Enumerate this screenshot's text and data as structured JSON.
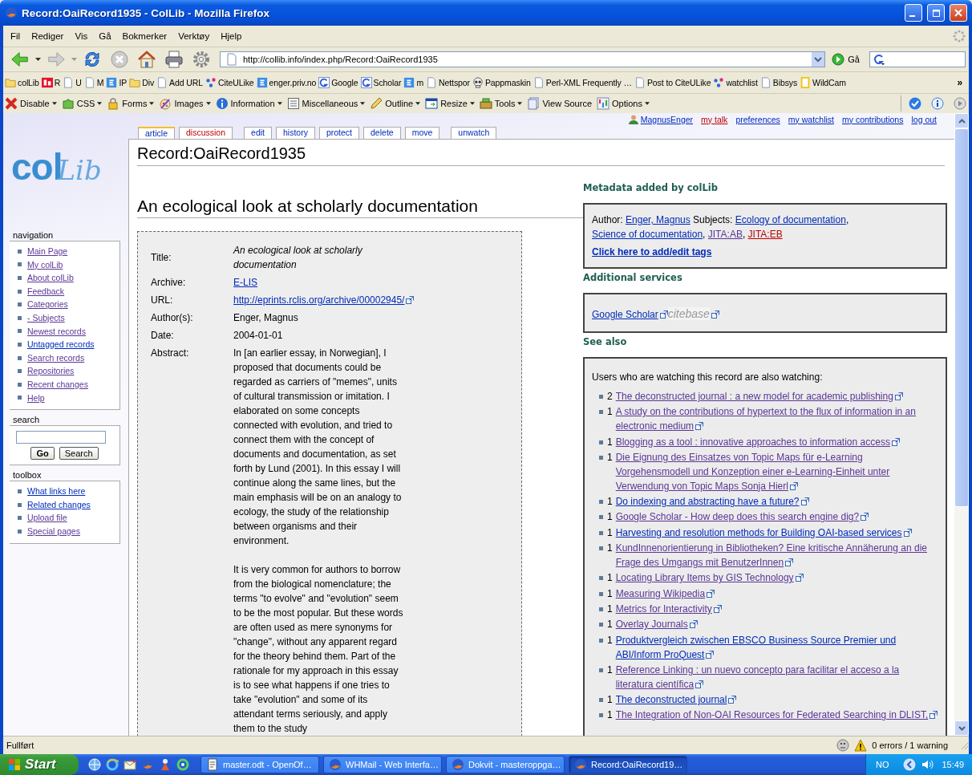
{
  "window": {
    "title": "Record:OaiRecord1935 - ColLib - Mozilla Firefox"
  },
  "menu": [
    "Fil",
    "Rediger",
    "Vis",
    "Gå",
    "Bokmerker",
    "Verktøy",
    "Hjelp"
  ],
  "address": {
    "url": "http://collib.info/index.php/Record:OaiRecord1935",
    "go_label": "Gå"
  },
  "bookmarks": [
    {
      "label": "colLib",
      "kind": "folder"
    },
    {
      "label": "R",
      "kind": "tile-red"
    },
    {
      "label": "U",
      "kind": "page"
    },
    {
      "label": "M",
      "kind": "page"
    },
    {
      "label": "IP",
      "kind": "tile-blue"
    },
    {
      "label": "Div",
      "kind": "folder"
    },
    {
      "label": "Add URL",
      "kind": "page"
    },
    {
      "label": "CiteULike",
      "kind": "dots"
    },
    {
      "label": "enger.priv.no",
      "kind": "tile-blue"
    },
    {
      "label": "Google",
      "kind": "ring"
    },
    {
      "label": "Scholar",
      "kind": "ring"
    },
    {
      "label": "m",
      "kind": "tile-blue"
    },
    {
      "label": "Nettspor",
      "kind": "page"
    },
    {
      "label": "Pappmaskin",
      "kind": "skull"
    },
    {
      "label": "Perl-XML Frequently …",
      "kind": "page"
    },
    {
      "label": "Post to CiteULike",
      "kind": "page"
    },
    {
      "label": "watchlist",
      "kind": "dots"
    },
    {
      "label": "Bibsys",
      "kind": "page"
    },
    {
      "label": "WildCam",
      "kind": "frame"
    }
  ],
  "bookmarks_more": "»",
  "dev_toolbar": [
    {
      "label": "Disable",
      "kind": "cross",
      "menu": true
    },
    {
      "label": "CSS",
      "kind": "puzzle",
      "menu": true
    },
    {
      "label": "Forms",
      "kind": "lock",
      "menu": true
    },
    {
      "label": "Images",
      "kind": "brush",
      "menu": true
    },
    {
      "label": "Information",
      "kind": "info",
      "menu": true
    },
    {
      "label": "Miscellaneous",
      "kind": "list",
      "menu": true
    },
    {
      "label": "Outline",
      "kind": "pencil",
      "menu": true
    },
    {
      "label": "Resize",
      "kind": "window",
      "menu": true
    },
    {
      "label": "Tools",
      "kind": "box",
      "menu": true
    },
    {
      "label": "View Source",
      "kind": "page",
      "menu": false
    },
    {
      "label": "Options",
      "kind": "sliders",
      "menu": true
    }
  ],
  "page": {
    "logo": "colLib",
    "user_links": [
      {
        "label": "MagnusEnger",
        "kind": "user"
      },
      {
        "label": "my talk",
        "kind": "new"
      },
      {
        "label": "preferences",
        "kind": "link"
      },
      {
        "label": "my watchlist",
        "kind": "link"
      },
      {
        "label": "my contributions",
        "kind": "link"
      },
      {
        "label": "log out",
        "kind": "link"
      }
    ],
    "tab_groups": [
      [
        {
          "label": "article",
          "selected": true,
          "kind": "link"
        },
        {
          "label": "discussion",
          "selected": false,
          "kind": "new"
        }
      ],
      [
        {
          "label": "edit",
          "selected": false,
          "kind": "link"
        },
        {
          "label": "history",
          "selected": false,
          "kind": "link"
        },
        {
          "label": "protect",
          "selected": false,
          "kind": "link"
        },
        {
          "label": "delete",
          "selected": false,
          "kind": "link"
        },
        {
          "label": "move",
          "selected": false,
          "kind": "link"
        }
      ],
      [
        {
          "label": "unwatch",
          "selected": false,
          "kind": "link"
        }
      ]
    ],
    "navigation": {
      "title": "navigation",
      "items": [
        {
          "label": "Main Page",
          "visited": true
        },
        {
          "label": "My colLib",
          "visited": true
        },
        {
          "label": "About colLib",
          "visited": true
        },
        {
          "label": "Feedback",
          "visited": true
        },
        {
          "label": "Categories",
          "visited": true
        },
        {
          "label": "- Subjects",
          "visited": true
        },
        {
          "label": "Newest records",
          "visited": true
        },
        {
          "label": "Untagged records",
          "visited": false
        },
        {
          "label": "Search records",
          "visited": true
        },
        {
          "label": "Repositories",
          "visited": true
        },
        {
          "label": "Recent changes",
          "visited": true
        },
        {
          "label": "Help",
          "visited": true
        }
      ]
    },
    "search": {
      "title": "search",
      "go": "Go",
      "search": "Search"
    },
    "toolbox": {
      "title": "toolbox",
      "items": [
        {
          "label": "What links here",
          "visited": false
        },
        {
          "label": "Related changes",
          "visited": false
        },
        {
          "label": "Upload file",
          "visited": true
        },
        {
          "label": "Special pages",
          "visited": true
        }
      ]
    },
    "page_title": "Record:OaiRecord1935",
    "record": {
      "heading": "An ecological look at scholarly documentation",
      "fields": [
        {
          "label": "Title:",
          "kind": "italic",
          "value": "An ecological look at scholarly documentation"
        },
        {
          "label": "Archive:",
          "kind": "link",
          "value": "E-LIS"
        },
        {
          "label": "URL:",
          "kind": "external",
          "value": "http://eprints.rclis.org/archive/00002945/"
        },
        {
          "label": "Author(s):",
          "kind": "text",
          "value": "Enger, Magnus"
        },
        {
          "label": "Date:",
          "kind": "text",
          "value": "2004-01-01"
        },
        {
          "label": "Abstract:",
          "kind": "paragraphs",
          "paragraphs": [
            "In [an earlier essay, in Norwegian], I proposed that documents could be regarded as carriers of \"memes\", units of cultural transmission or imitation. I elaborated on some concepts connected with evolution, and tried to connect them with the concept of documents and documentation, as set forth by Lund (2001). In this essay I will continue along the same lines, but the main emphasis will be on an analogy to ecology, the study of the relationship between organisms and their environment.",
            "It is very common for authors to borrow from the biological nomenclature; the terms \"to evolve\" and \"evolution\" seem to be the most popular. But these words are often used as mere synonyms for \"change\", without any apparent regard for the theory behind them. Part of the rationale for my approach in this essay is to see what happens if one tries to take \"evolution\" and some of its attendant terms seriously, and apply them to the study"
          ]
        }
      ]
    },
    "metadata": {
      "heading": "Metadata added by colLib",
      "author_label": "Author:",
      "author": "Enger, Magnus",
      "subjects_label": "Subjects:",
      "subjects": [
        {
          "label": "Ecology of documentation",
          "kind": "link",
          "after": ","
        },
        {
          "label": "Science of documentation",
          "kind": "link",
          "after": ","
        },
        {
          "label": "JITA:AB",
          "kind": "visited",
          "after": ","
        },
        {
          "label": "JITA:EB",
          "kind": "new"
        }
      ],
      "tags_link": "Click here to add/edit tags"
    },
    "services": {
      "heading": "Additional services",
      "links": [
        {
          "label": "Google Scholar",
          "kind": "link"
        },
        {
          "label": "citebase",
          "kind": "disabled"
        }
      ]
    },
    "see_also": {
      "heading": "See also",
      "intro": "Users who are watching this record are also watching:",
      "items": [
        {
          "count": "2",
          "title": "The deconstructed journal : a new model for academic publishing",
          "visited": true
        },
        {
          "count": "1",
          "title": "A study on the contributions of hypertext to the flux of information in an electronic medium",
          "visited": true
        },
        {
          "count": "1",
          "title": "Blogging as a tool : innovative approaches to information access",
          "visited": true
        },
        {
          "count": "1",
          "title": "Die Eignung des Einsatzes von Topic Maps für e-Learning Vorgehensmodell und Konzeption einer e-Learning-Einheit unter Verwendung von Topic Maps Sonja Hierl",
          "visited": true
        },
        {
          "count": "1",
          "title": "Do indexing and abstracting have a future?",
          "visited": false
        },
        {
          "count": "1",
          "title": "Google Scholar - How deep does this search engine dig?",
          "visited": true
        },
        {
          "count": "1",
          "title": "Harvesting and resolution methods for Building OAI-based services",
          "visited": false
        },
        {
          "count": "1",
          "title": "KundInnenorientierung in Bibliotheken? Eine kritische Annäherung an die Frage des Umgangs mit BenutzerInnen",
          "visited": true
        },
        {
          "count": "1",
          "title": "Locating Library Items by GIS Technology",
          "visited": true
        },
        {
          "count": "1",
          "title": "Measuring Wikipedia",
          "visited": true
        },
        {
          "count": "1",
          "title": "Metrics for Interactivity",
          "visited": true
        },
        {
          "count": "1",
          "title": "Overlay Journals",
          "visited": true
        },
        {
          "count": "1",
          "title": "Produktvergleich zwischen EBSCO Business Source Premier und ABI/Inform ProQuest",
          "visited": false
        },
        {
          "count": "1",
          "title": "Reference Linking : un nuevo concepto para facilitar el acceso a la literatura científica",
          "visited": true
        },
        {
          "count": "1",
          "title": "The deconstructed journal",
          "visited": false
        },
        {
          "count": "1",
          "title": "The Integration of Non-OAI Resources for Federated Searching in DLIST,",
          "visited": true
        }
      ]
    }
  },
  "status_bar": {
    "text": "Fullført",
    "report": "0 errors / 1 warning"
  },
  "taskbar": {
    "start": "Start",
    "tasks": [
      {
        "label": "master.odt - OpenOf…",
        "selected": false,
        "kind": "document"
      },
      {
        "label": "WHMail - Web Interfa…",
        "selected": false,
        "kind": "browser"
      },
      {
        "label": "Dokvit - masteroppga…",
        "selected": false,
        "kind": "browser"
      },
      {
        "label": "Record:OaiRecord19…",
        "selected": true,
        "kind": "browser"
      }
    ],
    "language": "NO",
    "clock": "15:49"
  }
}
